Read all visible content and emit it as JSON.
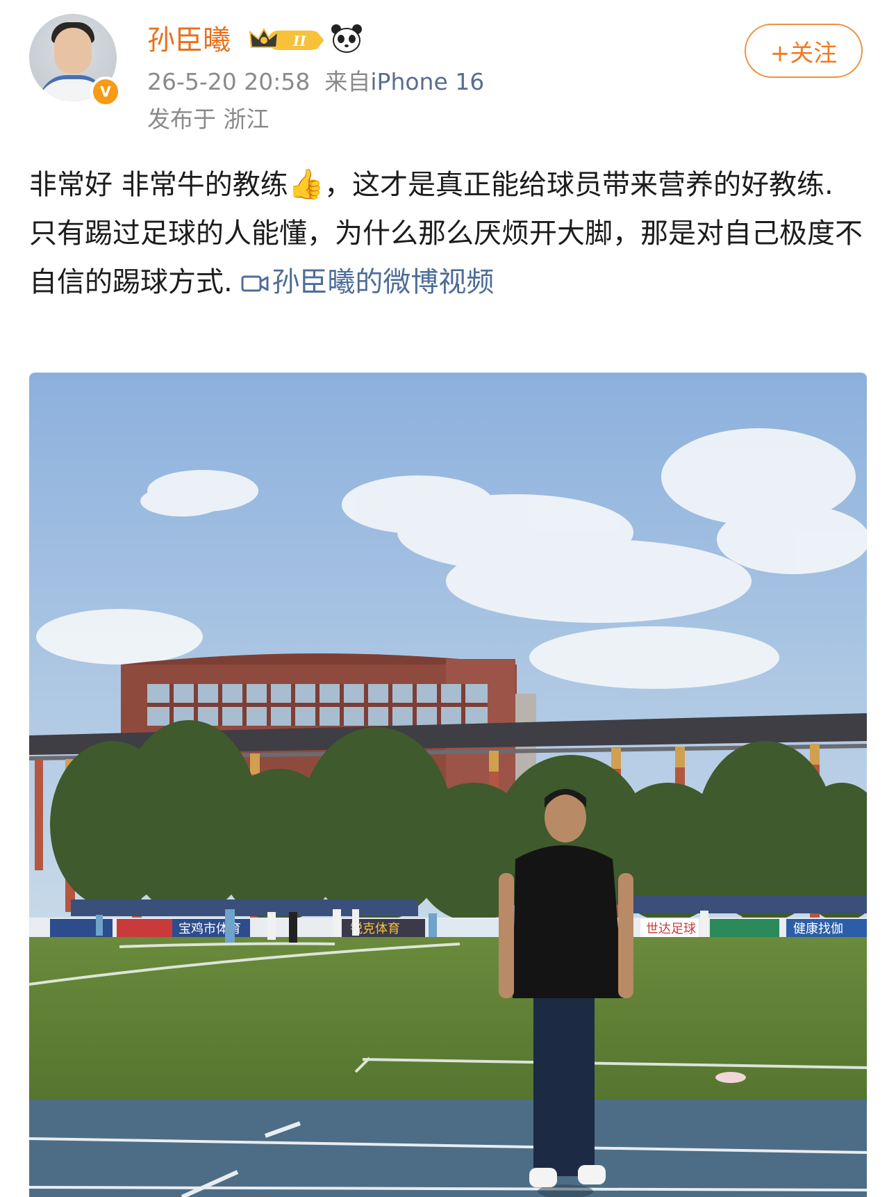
{
  "post": {
    "username": "孙臣曦",
    "timestamp": "26-5-20 20:58",
    "source_prefix": "来自",
    "device": "iPhone 16",
    "location": "发布于 浙江",
    "follow_label": "+关注",
    "verified_badge": "V",
    "text_part1": "非常好 非常牛的教练",
    "text_emoji": "👍",
    "text_part2": "，这才是真正能给球员带来营养的好教练.",
    "text_part3": "只有踢过足球的人能懂，为什么那么厌烦开大脚，那是对自己极度不自信的踢球方式.",
    "video_link": "孙臣曦的微博视频",
    "badge_level": "II"
  },
  "media": {
    "banners": [
      "宝鸡市体育",
      "世达足球",
      "健康找伽",
      "锐克体育"
    ],
    "colors": {
      "sky_top": "#8fb3df",
      "sky_bottom": "#c9dbea",
      "building": "#8f4a3e",
      "pillar": "#b55640",
      "grass": "#5f7f35",
      "track": "#4d6d86"
    }
  }
}
